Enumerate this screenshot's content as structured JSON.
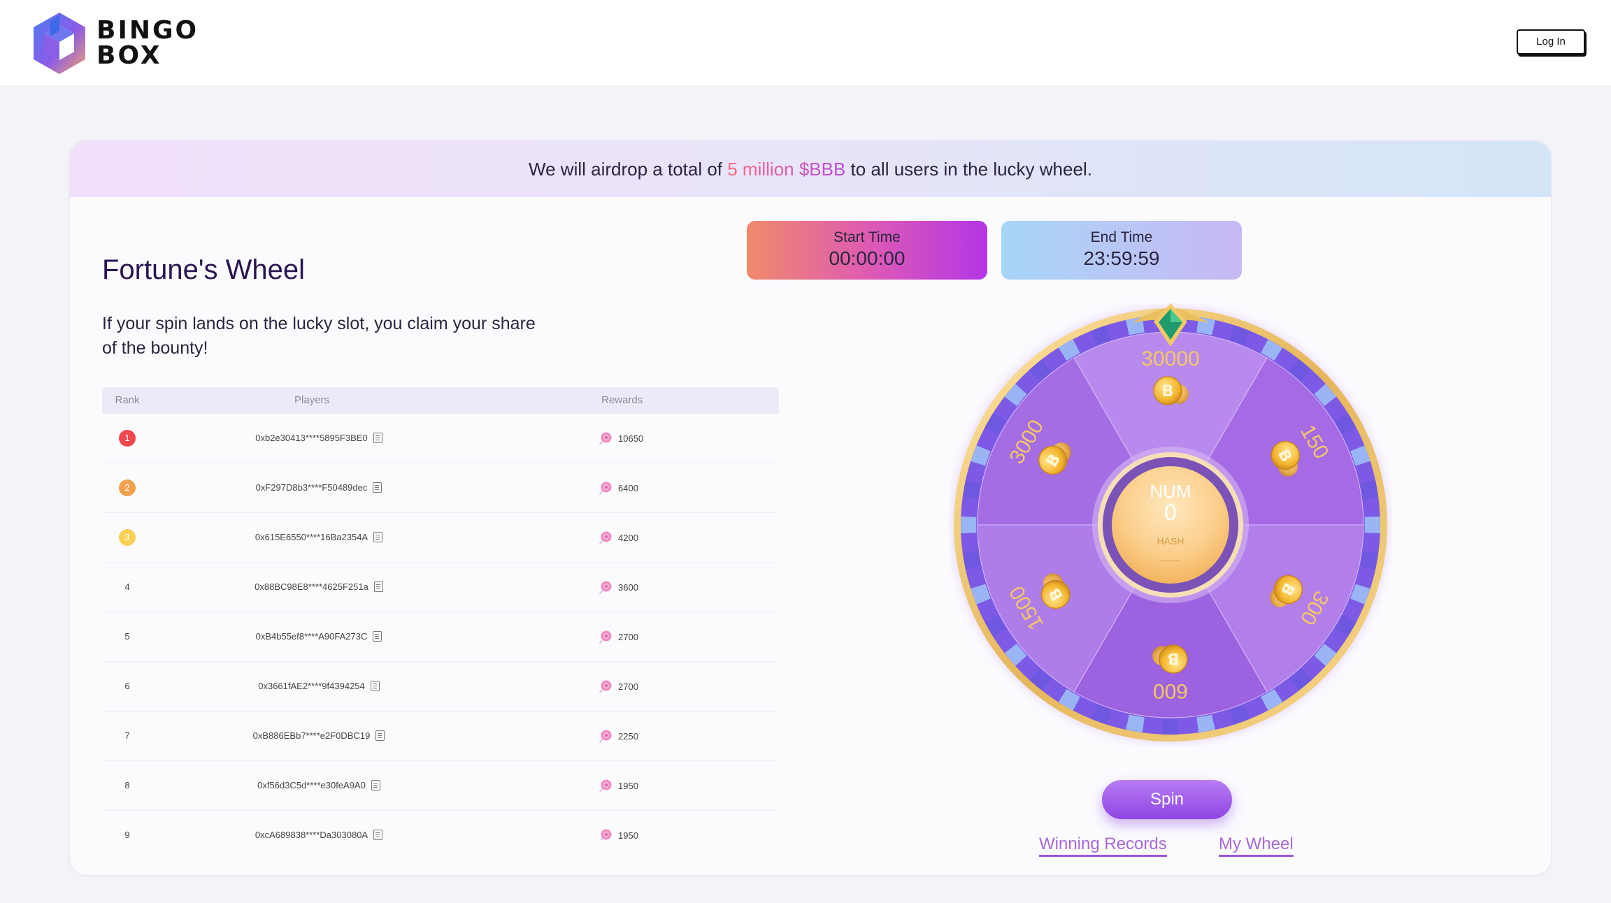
{
  "header": {
    "logo_text_line1": "BINGO",
    "logo_text_line2": "BOX",
    "login_label": "Log In"
  },
  "banner": {
    "prefix": "We will airdrop a total of ",
    "highlight": "5 million $BBB",
    "suffix": " to all users in the lucky wheel."
  },
  "intro": {
    "title": "Fortune's Wheel",
    "description": "If your spin lands on the lucky slot, you claim your share of the bounty!"
  },
  "leaderboard": {
    "columns": {
      "rank": "Rank",
      "players": "Players",
      "rewards": "Rewards"
    },
    "rows": [
      {
        "rank": "1",
        "player": "0xb2e30413****5895F3BE0",
        "reward": "10650"
      },
      {
        "rank": "2",
        "player": "0xF297D8b3****F50489dec",
        "reward": "6400"
      },
      {
        "rank": "3",
        "player": "0x615E6550****16Ba2354A",
        "reward": "4200"
      },
      {
        "rank": "4",
        "player": "0x88BC98E8****4625F251a",
        "reward": "3600"
      },
      {
        "rank": "5",
        "player": "0xB4b55ef8****A90FA273C",
        "reward": "2700"
      },
      {
        "rank": "6",
        "player": "0x3661fAE2****9f4394254",
        "reward": "2700"
      },
      {
        "rank": "7",
        "player": "0xB886EBb7****e2F0DBC19",
        "reward": "2250"
      },
      {
        "rank": "8",
        "player": "0xf56d3C5d****e30feA9A0",
        "reward": "1950"
      },
      {
        "rank": "9",
        "player": "0xcA689838****Da303080A",
        "reward": "1950"
      }
    ],
    "rank_colors": [
      "#f0484f",
      "#f2a24c",
      "#f7d055"
    ]
  },
  "times": {
    "start_label": "Start Time",
    "start_value": "00:00:00",
    "end_label": "End Time",
    "end_value": "23:59:59"
  },
  "wheel": {
    "segments": [
      "30000",
      "150",
      "300",
      "600",
      "1500",
      "3000"
    ],
    "center_label": "NUM",
    "center_value": "0",
    "hash_label": "HASH",
    "hash_value": "——"
  },
  "actions": {
    "spin_label": "Spin",
    "winning_records_label": "Winning Records",
    "my_wheel_label": "My Wheel"
  },
  "colors": {
    "accent_purple": "#9b55d6",
    "wheel_gold": "#f0c56a",
    "title_color": "#2a1552"
  }
}
